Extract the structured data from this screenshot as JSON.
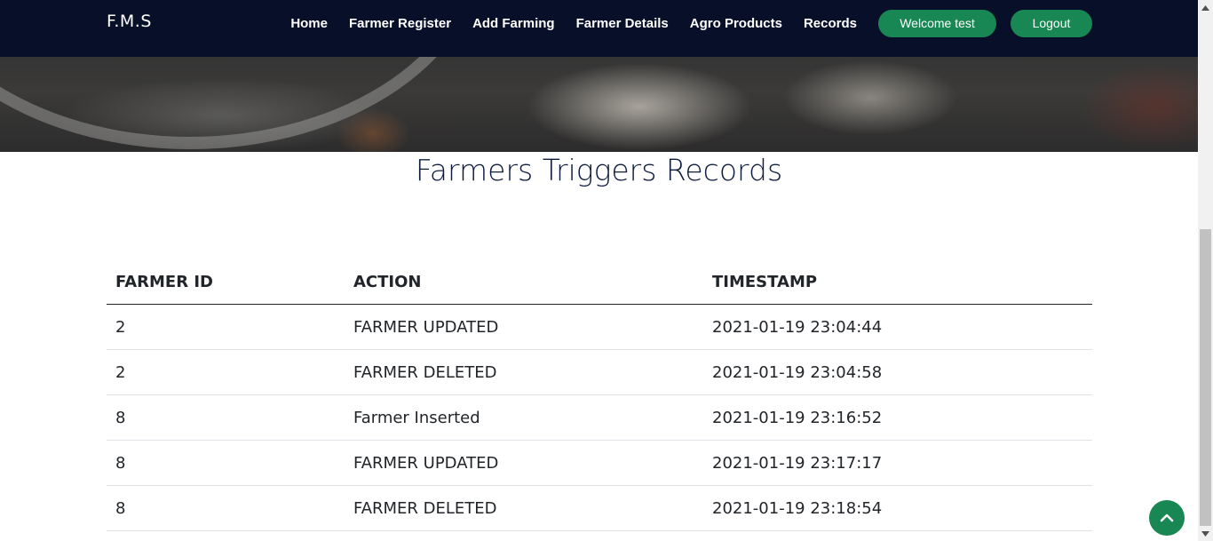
{
  "navbar": {
    "brand": "F.M.S",
    "links": [
      "Home",
      "Farmer Register",
      "Add Farming",
      "Farmer Details",
      "Agro Products",
      "Records"
    ],
    "welcome_button": "Welcome test",
    "logout_button": "Logout",
    "button_color": "#198754",
    "background_color": "#081029"
  },
  "page": {
    "title": "Farmers Triggers Records"
  },
  "table": {
    "headers": [
      "FARMER ID",
      "ACTION",
      "TIMESTAMP"
    ],
    "rows": [
      [
        "2",
        "FARMER UPDATED",
        "2021-01-19 23:04:44"
      ],
      [
        "2",
        "FARMER DELETED",
        "2021-01-19 23:04:58"
      ],
      [
        "8",
        "Farmer Inserted",
        "2021-01-19 23:16:52"
      ],
      [
        "8",
        "FARMER UPDATED",
        "2021-01-19 23:17:17"
      ],
      [
        "8",
        "FARMER DELETED",
        "2021-01-19 23:18:54"
      ]
    ]
  },
  "icons": {
    "back_to_top": "chevron-up-icon",
    "scroll_up": "triangle-up-icon",
    "scroll_down": "triangle-down-icon"
  }
}
